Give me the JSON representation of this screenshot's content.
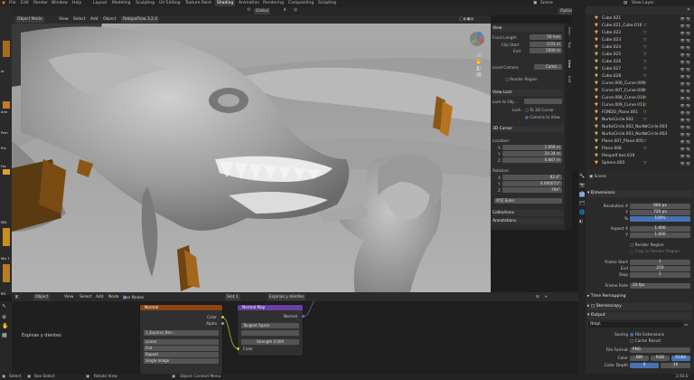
{
  "topbar": {
    "menus": [
      "File",
      "Edit",
      "Render",
      "Window",
      "Help"
    ],
    "workspaces": [
      "Layout",
      "Modeling",
      "Sculpting",
      "UV Editing",
      "Texture Paint",
      "Shading",
      "Animation",
      "Rendering",
      "Compositing",
      "Scripting"
    ],
    "active_workspace": "Shading",
    "scene": "Scene",
    "view_layer": "View Layer"
  },
  "left_strip": [
    "Ar",
    "Arm",
    "Fem",
    "Fac",
    "Pre",
    "MIX",
    "Mix T",
    "RG"
  ],
  "viewport_header": {
    "mode": "Object Mode",
    "menus": [
      "View",
      "Select",
      "Add",
      "Object"
    ],
    "engine": "RetopoFlow 3.2.4",
    "orientation": "Global",
    "options": "Options"
  },
  "npanel": {
    "view_section": "View",
    "focal_length_label": "Focal Length",
    "focal_length": "50 mm",
    "clip_start_label": "Clip Start",
    "clip_start": "0.01 m",
    "end_label": "End",
    "end": "1000 m",
    "local_camera_label": "Local Camera",
    "local_camera_value": "Came...",
    "render_region": "Render Region",
    "view_lock_section": "View Lock",
    "lock_to_object_label": "Lock to Obj...",
    "lock_label": "Lock",
    "to_3d_cursor": "To 3D Cursor",
    "camera_to_view": "Camera to View",
    "cursor_section": "3D Cursor",
    "location_label": "Location:",
    "loc_x": "1.956 m",
    "loc_y": "24.34 m",
    "loc_z": "6.847 m",
    "rotation_label": "Rotation:",
    "rot_x": "82.4°",
    "rot_y": "0.000073°",
    "rot_z": "794°",
    "rotation_mode": "XYZ Euler",
    "collections_section": "Collections",
    "annotations_section": "Annotations",
    "tabs": [
      "Item",
      "Tool",
      "View",
      "Edit"
    ]
  },
  "outliner": {
    "rows": [
      {
        "name": "Cube.021",
        "tag": ""
      },
      {
        "name": "Cube.021_Cube.016",
        "tag": "▽"
      },
      {
        "name": "Cube.022",
        "tag": "▽"
      },
      {
        "name": "Cube.023",
        "tag": "▽"
      },
      {
        "name": "Cube.024",
        "tag": "▽"
      },
      {
        "name": "Cube.025",
        "tag": "▽"
      },
      {
        "name": "Cube.026",
        "tag": "▽"
      },
      {
        "name": "Cube.027",
        "tag": "▽"
      },
      {
        "name": "Cube.028",
        "tag": "▽"
      },
      {
        "name": "Curve.006_Curve.009",
        "tag": "▽"
      },
      {
        "name": "Curve.007_Curve.008",
        "tag": "▽"
      },
      {
        "name": "Curve.008_Curve.010",
        "tag": "▽"
      },
      {
        "name": "Curve.009_Curve.011",
        "tag": "▽"
      },
      {
        "name": "FONDO_Plane.001",
        "tag": "▽"
      },
      {
        "name": "NurbsCircle.002",
        "tag": "▽"
      },
      {
        "name": "NurbsCircle.002_NurbsCircle.003",
        "tag": "▽"
      },
      {
        "name": "NurbsCircle.003_NurbsCircle.003",
        "tag": "▽"
      },
      {
        "name": "Plane.007_Plane.005",
        "tag": "▽"
      },
      {
        "name": "Plane.008",
        "tag": "▽"
      },
      {
        "name": "Pelopelf bez.019",
        "tag": ""
      },
      {
        "name": "Sphere.005",
        "tag": "▽"
      }
    ]
  },
  "properties": {
    "scene_label": "Scene",
    "dimensions_section": "Dimensions",
    "res_x_label": "Resolution X",
    "res_x": "960 px",
    "res_y_label": "Y",
    "res_y": "720 px",
    "res_pct_label": "%",
    "res_pct": "100%",
    "aspect_x_label": "Aspect X",
    "aspect_x": "1.000",
    "aspect_y_label": "Y",
    "aspect_y": "1.000",
    "render_region": "Render Region",
    "crop": "Crop to Render Region",
    "frame_start_label": "Frame Start",
    "frame_start": "1",
    "end_label": "End",
    "end": "250",
    "step_label": "Step",
    "step": "1",
    "frame_rate_label": "Frame Rate",
    "frame_rate": "24 fps",
    "time_remapping": "Time Remapping",
    "stereoscopy": "Stereoscopy",
    "output_section": "Output",
    "output_path": "/tmp\\",
    "saving_label": "Saving",
    "file_extensions": "File Extensions",
    "cache_result": "Cache Result",
    "file_format_label": "File Format",
    "file_format": "PNG",
    "color_label": "Color",
    "color_bw": "BW",
    "color_rgb": "RGB",
    "color_rgba": "RGBA",
    "color_depth_label": "Color Depth",
    "depth_8": "8",
    "depth_16": "16"
  },
  "node_header": {
    "type": "Object",
    "menus": [
      "View",
      "Select",
      "Add",
      "Node"
    ],
    "use_nodes": "Use Nodes",
    "slot": "Slot 1",
    "material": "Espinas y dientes"
  },
  "node_editor": {
    "material_label": "Espinas y dientes",
    "image_node": {
      "title": "Normal",
      "color": "Color",
      "alpha": "Alpha",
      "image": "1_Espinas_Bon...",
      "interp": "Linear",
      "proj": "Flat",
      "ext": "Repeat",
      "src": "Single Image"
    },
    "normal_node": {
      "title": "Normal Map",
      "out": "Normal",
      "space": "Tangent Space",
      "strength_label": "Strength",
      "strength": "2.000",
      "color_in": "Color"
    }
  },
  "status": {
    "select": "Select",
    "box_select": "Box Select",
    "rotate": "Rotate View",
    "context": "Object Context Menu",
    "version": "2.92.0"
  },
  "colors": {
    "accent_blue": "#4772b3",
    "outliner_orange": "#ffa94d",
    "green": "#73c05a",
    "image_node_header": "#8b4513",
    "vector_node_header": "#6a3fa0"
  }
}
